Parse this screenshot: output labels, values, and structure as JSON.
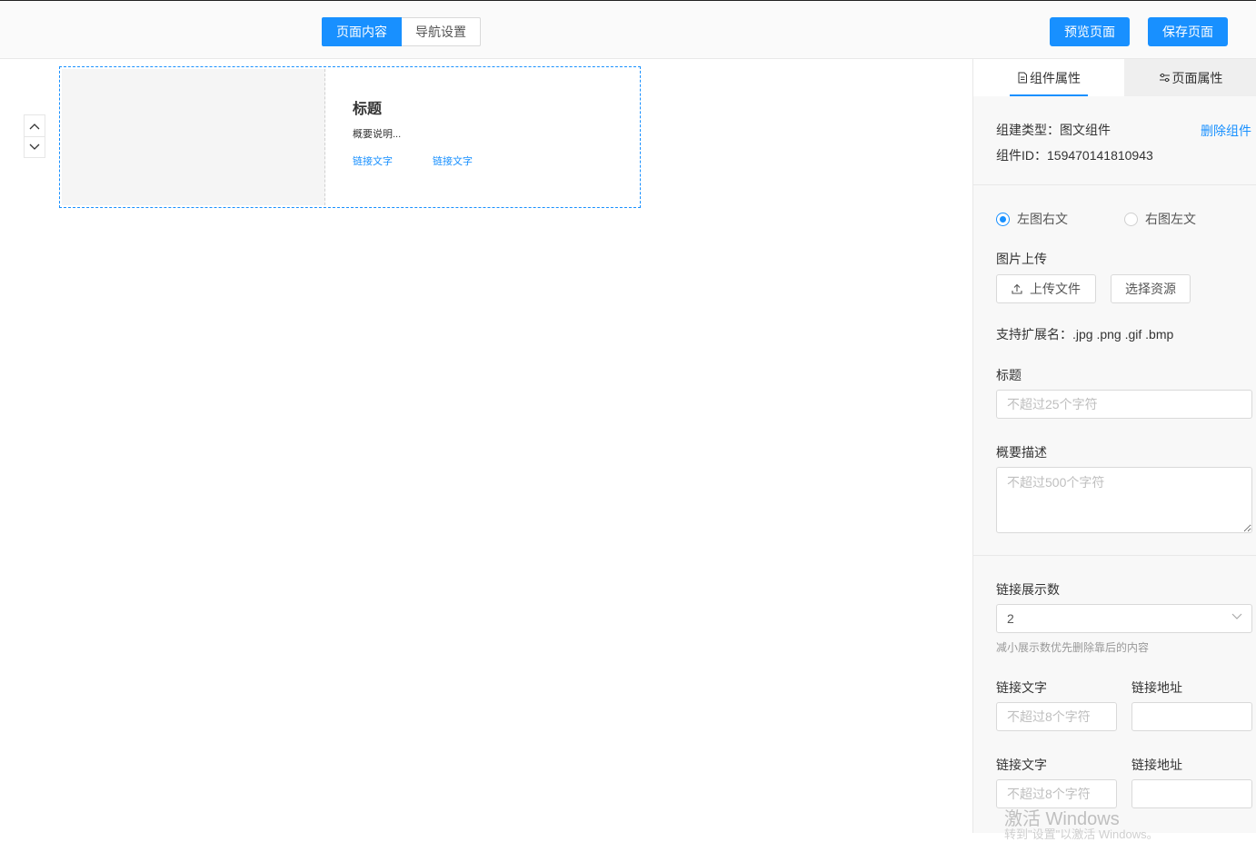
{
  "header": {
    "tabs": [
      "页面内容",
      "导航设置"
    ],
    "preview_label": "预览页面",
    "save_label": "保存页面"
  },
  "canvas": {
    "card": {
      "title": "标题",
      "desc": "概要说明...",
      "links": [
        "链接文字",
        "链接文字"
      ]
    }
  },
  "panel": {
    "tabs": [
      "组件属性",
      "页面属性"
    ],
    "type_label": "组建类型：图文组件",
    "delete_label": "删除组件",
    "id_label": "组件ID：159470141810943",
    "layout_options": [
      "左图右文",
      "右图左文"
    ],
    "layout_selected": "左图右文",
    "upload_title": "图片上传",
    "upload_button": "上传文件",
    "choose_button": "选择资源",
    "ext_label": "支持扩展名：.jpg .png .gif .bmp",
    "title_label": "标题",
    "title_placeholder": "不超过25个字符",
    "desc_label": "概要描述",
    "desc_placeholder": "不超过500个字符",
    "link_count_label": "链接展示数",
    "link_count_value": "2",
    "link_count_hint": "减小展示数优先删除靠后的内容",
    "link_rows": [
      {
        "text_label": "链接文字",
        "text_placeholder": "不超过8个字符",
        "url_label": "链接地址",
        "url_value": ""
      },
      {
        "text_label": "链接文字",
        "text_placeholder": "不超过8个字符",
        "url_label": "链接地址",
        "url_value": ""
      }
    ]
  },
  "watermark": {
    "line1": "激活 Windows",
    "line2": "转到\"设置\"以激活 Windows。"
  },
  "colors": {
    "accent": "#1890ff",
    "panel_bg": "#f8f8f8"
  }
}
